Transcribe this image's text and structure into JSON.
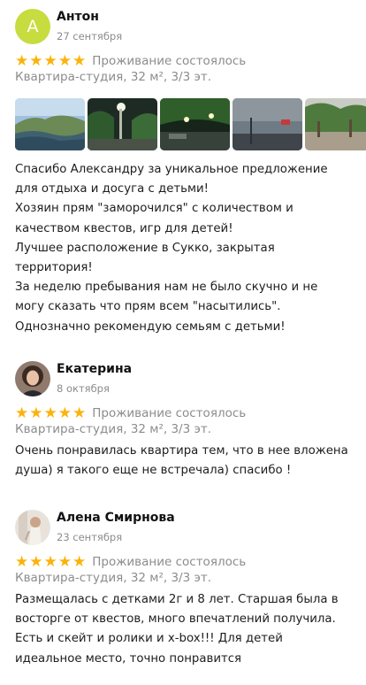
{
  "common": {
    "star_glyph": "★",
    "star_color": "#fbb30b",
    "rating": 5
  },
  "reviews": [
    {
      "avatar_letter": "А",
      "avatar_color": "#c6dc3f",
      "name": "Антон",
      "date": "27 сентября",
      "stay": "Проживание состоялось",
      "apartment": "Квартира-студия, 32 м², 3/3 эт.",
      "text_lines": [
        "Спасибо Александру за уникальное предложение",
        "для отдыха и досуга с детьми!",
        "Хозяин прям \"заморочился\" с количеством и",
        "качеством квестов, игр для детей!",
        "Лучшее расположение в Сукко, закрытая",
        "территория!",
        "За неделю пребывания нам не было скучно и не",
        "могу сказать что прям всем \"насытились\".",
        "Однозначно рекомендую семьям с детьми!"
      ]
    },
    {
      "name": "Екатерина",
      "date": "8 октября",
      "stay": "Проживание состоялось",
      "apartment": "Квартира-студия, 32 м², 3/3 эт.",
      "text_lines": [
        "Очень понравилась квартира тем, что в нее вложена",
        "душа) я такого еще не встречала) спасибо !"
      ]
    },
    {
      "name": "Алена Смирнова",
      "date": "23 сентября",
      "stay": "Проживание состоялось",
      "apartment": "Квартира-студия, 32 м², 3/3 эт.",
      "text_lines": [
        "Размещалась с детками 2г и 8 лет. Старшая была в",
        "восторге от квестов, много впечатлений получила.",
        "Есть и скейт и ролики и x-box!!! Для детей",
        "идеальное место, точно понравится"
      ]
    }
  ]
}
